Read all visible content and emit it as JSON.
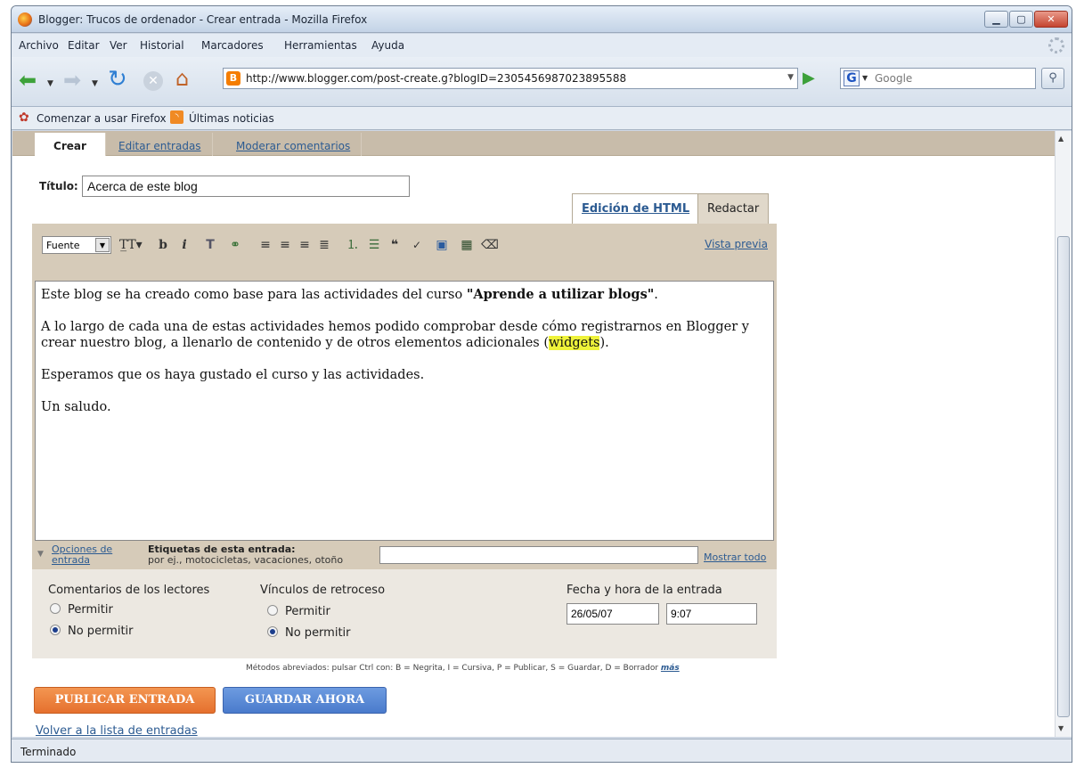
{
  "window": {
    "title": "Blogger: Trucos de ordenador - Crear entrada - Mozilla Firefox"
  },
  "menu": [
    "Archivo",
    "Editar",
    "Ver",
    "Historial",
    "Marcadores",
    "Herramientas",
    "Ayuda"
  ],
  "nav": {
    "url": "http://www.blogger.com/post-create.g?blogID=2305456987023895588",
    "search_placeholder": "Google",
    "search_engine_letter": "G"
  },
  "bookmarks": {
    "getting_started": "Comenzar a usar Firefox",
    "latest_news": "Últimas noticias"
  },
  "blogger_tabs": {
    "create": "Crear",
    "edit_posts": "Editar entradas",
    "moderate": "Moderar comentarios"
  },
  "post": {
    "title_label": "Título:",
    "title_value": "Acerca de este blog",
    "mode_html": "Edición de HTML",
    "mode_compose": "Redactar",
    "font_label": "Fuente",
    "preview_link": "Vista previa",
    "body": {
      "p1_text": "Este blog se ha creado como base para las actividades del curso ",
      "p1_bold": "\"Aprende a utilizar blogs\"",
      "p1_end": ".",
      "p2_text": "A lo largo de cada una de estas actividades hemos podido comprobar desde cómo registrarnos en Blogger y crear nuestro blog, a llenarlo de contenido y de otros elementos adicionales (",
      "p2_highlight": "widgets",
      "p2_end": ").",
      "p3": "Esperamos que os haya gustado el curso y las actividades.",
      "p4": "Un saludo."
    },
    "options_link_line1": "Opciones de",
    "options_link_line2": "entrada",
    "tags_label": "Etiquetas de esta entrada:",
    "tags_hint": "por ej., motocicletas, vacaciones, otoño",
    "show_all": "Mostrar todo"
  },
  "options": {
    "comments_title": "Comentarios de los lectores",
    "backlinks_title": "Vínculos de retroceso",
    "allow": "Permitir",
    "disallow": "No permitir",
    "date_title": "Fecha y hora de la entrada",
    "date_value": "26/05/07",
    "time_value": "9:07"
  },
  "shortcuts": {
    "text": "Métodos abreviados: pulsar Ctrl con: B = Negrita, I = Cursiva, P = Publicar, S = Guardar, D = Borrador",
    "more": "más"
  },
  "buttons": {
    "publish": "PUBLICAR ENTRADA",
    "save": "GUARDAR AHORA"
  },
  "back_link": "Volver a la lista de entradas",
  "status": "Terminado",
  "colors": {
    "accent_orange": "#e5702e",
    "accent_blue": "#4a7bcc",
    "link": "#2c5b92",
    "editor_frame": "#d6cbb9"
  }
}
